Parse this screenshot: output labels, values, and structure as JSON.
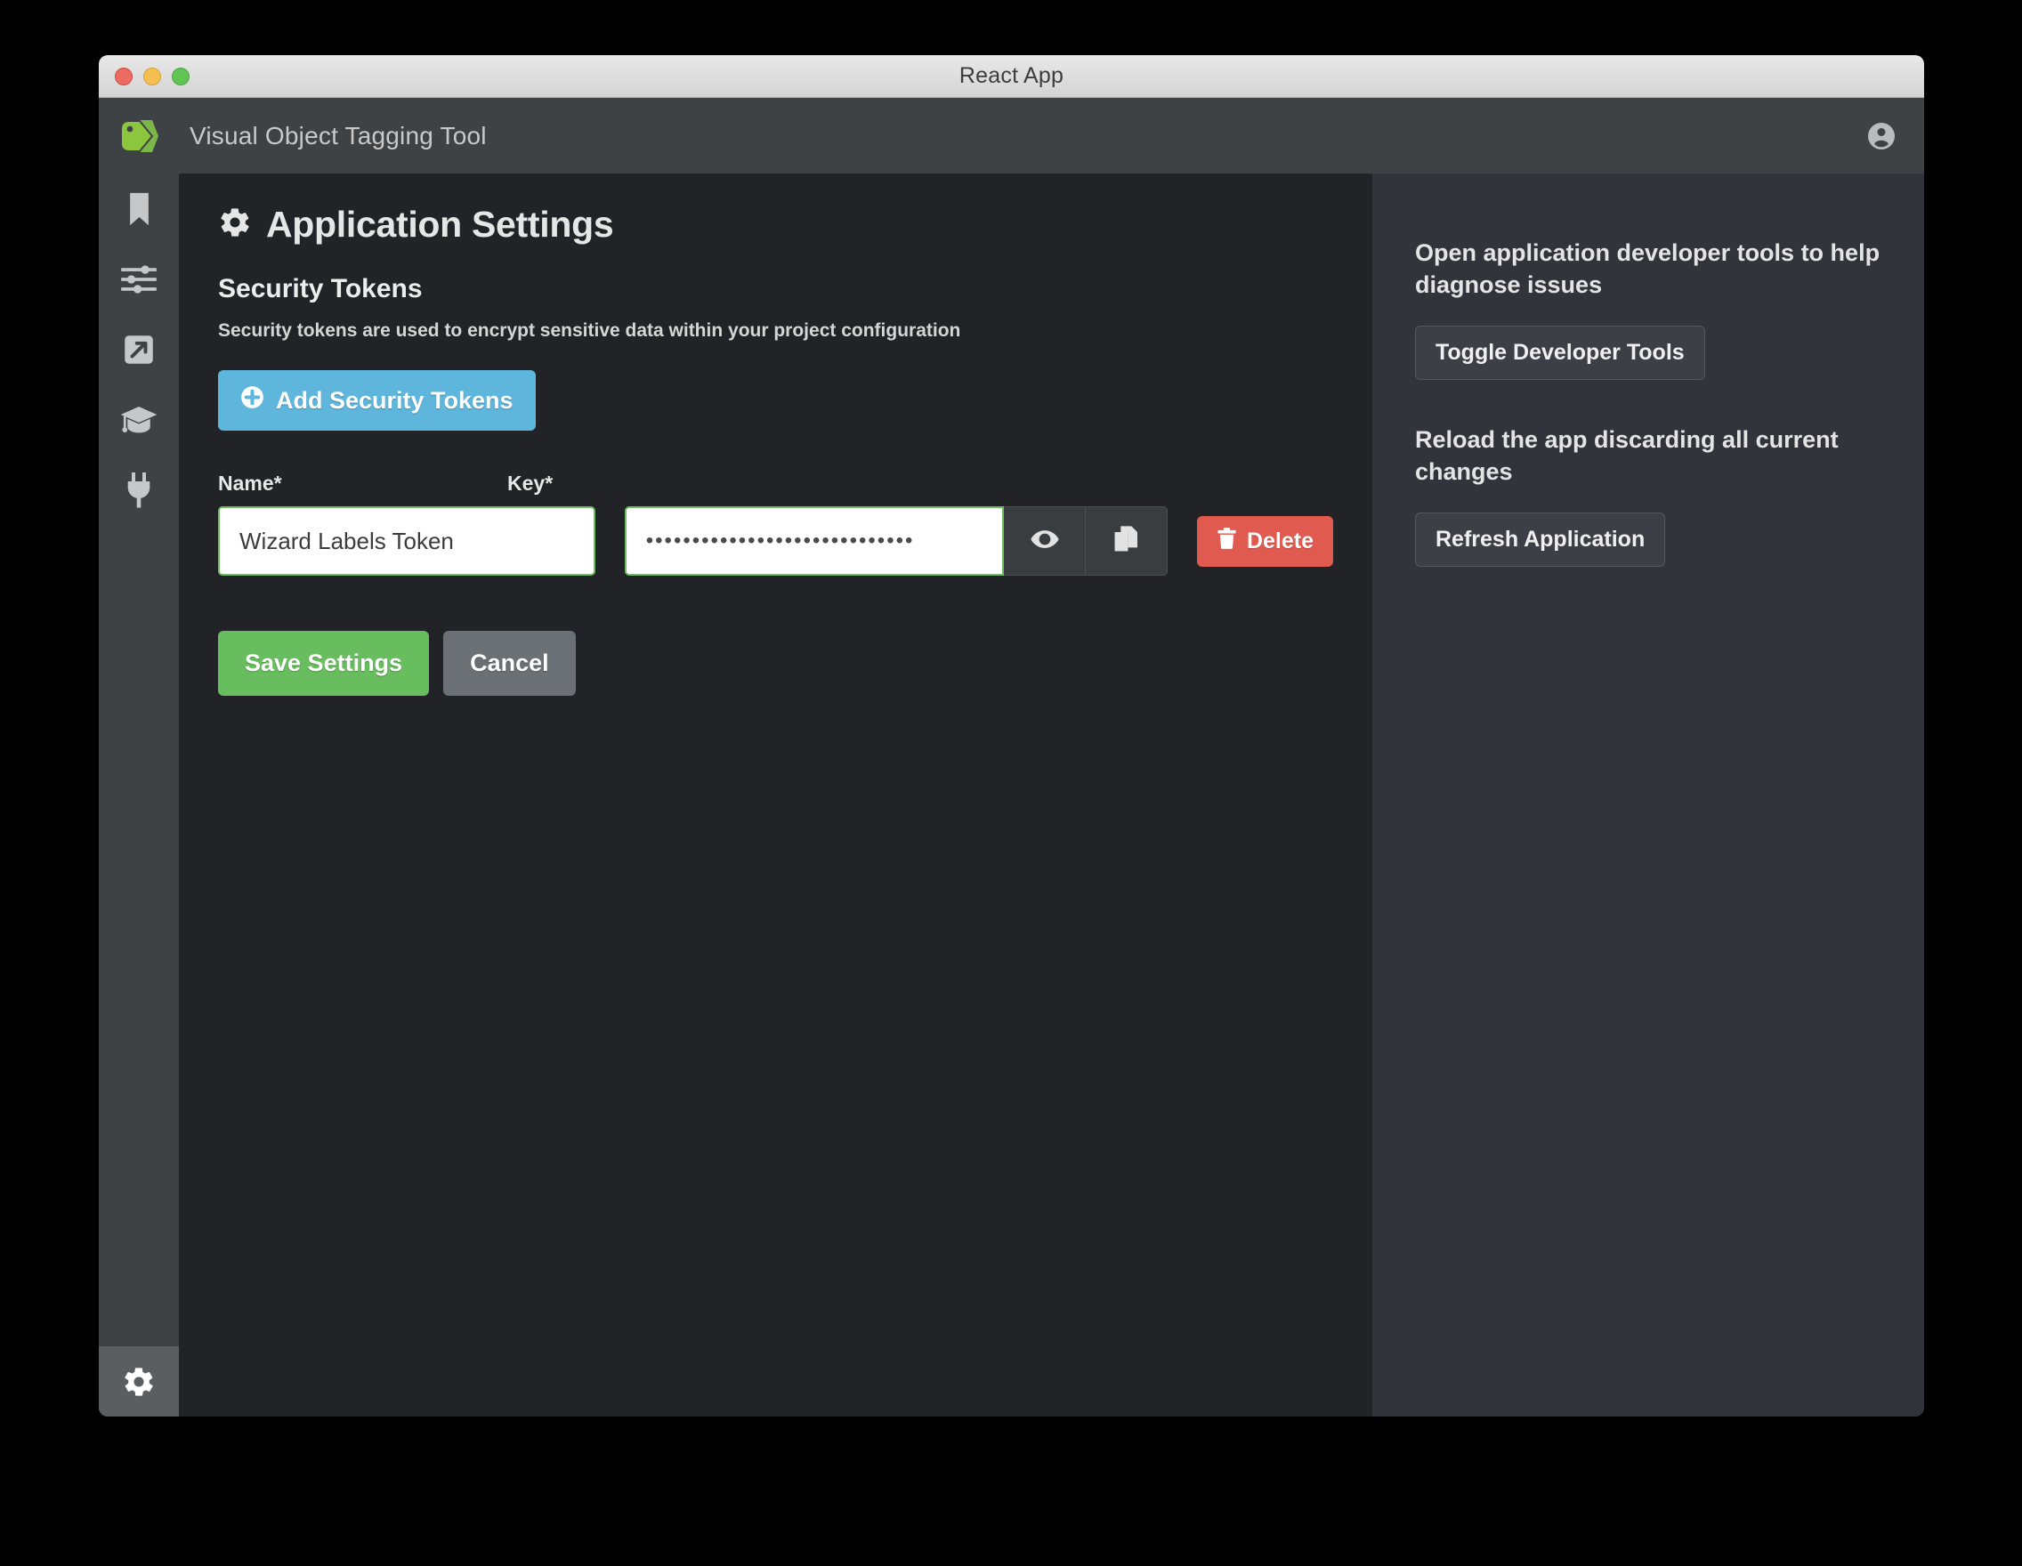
{
  "window": {
    "title": "React App",
    "traffic_lights": [
      "close-button",
      "minimize-button",
      "maximize-button"
    ]
  },
  "header": {
    "brand_title": "Visual Object Tagging Tool",
    "logo_icon": "tag-icon",
    "account_icon": "account-circle-icon"
  },
  "sidebar": {
    "items": [
      {
        "name": "sidebar-item-bookmark",
        "icon": "bookmark-icon",
        "active": false
      },
      {
        "name": "sidebar-item-settings-sliders",
        "icon": "sliders-icon",
        "active": false
      },
      {
        "name": "sidebar-item-export",
        "icon": "export-arrow-icon",
        "active": false
      },
      {
        "name": "sidebar-item-active-learning",
        "icon": "graduation-cap-icon",
        "active": false
      },
      {
        "name": "sidebar-item-connections",
        "icon": "plug-icon",
        "active": false
      }
    ],
    "bottom_item": {
      "name": "sidebar-item-app-settings",
      "icon": "gear-icon",
      "active": true
    }
  },
  "main": {
    "page_title": "Application Settings",
    "page_title_icon": "gear-icon",
    "section_title": "Security Tokens",
    "section_description": "Security tokens are used to encrypt sensitive data within your project configuration",
    "add_button": {
      "label": "Add Security Tokens",
      "icon": "plus-circle-icon",
      "color": "#5eb6dd"
    },
    "form": {
      "name_label": "Name*",
      "key_label": "Key*",
      "name_value": "Wizard Labels Token",
      "name_placeholder": "",
      "key_value": "•••••••••••••••••••••••••••••",
      "key_masked": true,
      "key_char_count": 29,
      "show_key_icon": "eye-icon",
      "copy_key_icon": "copy-icon",
      "delete_button": {
        "label": "Delete",
        "icon": "trash-icon",
        "color": "#e05a4f"
      },
      "valid_border_color": "#6bbf5e"
    },
    "actions": {
      "save_label": "Save Settings",
      "save_color": "#68bd5e",
      "cancel_label": "Cancel",
      "cancel_color": "#6b7075"
    }
  },
  "right_panel": {
    "devtools_text": "Open application developer tools to help diagnose issues",
    "devtools_button": "Toggle Developer Tools",
    "reload_text": "Reload the app discarding all current changes",
    "reload_button": "Refresh Application"
  }
}
